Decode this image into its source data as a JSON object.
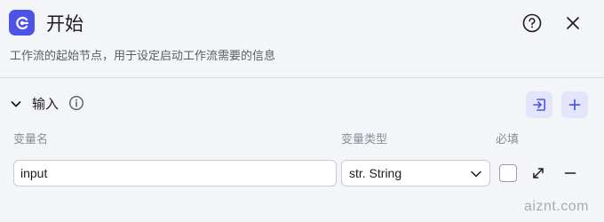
{
  "header": {
    "title": "开始",
    "description": "工作流的起始节点，用于设定启动工作流需要的信息",
    "icons": {
      "node": "start-node-icon",
      "help": "help-circle-icon",
      "close": "close-icon"
    }
  },
  "inputs_section": {
    "title": "输入",
    "icons": {
      "collapse": "chevron-down-icon",
      "info": "info-icon",
      "import": "import-icon",
      "add": "plus-icon"
    },
    "columns": {
      "name": "变量名",
      "type": "变量类型",
      "required": "必填"
    },
    "rows": [
      {
        "name": "input",
        "type": "str. String",
        "required": false
      }
    ]
  },
  "watermark": "aiznt.com",
  "colors": {
    "accent": "#4d53e8",
    "accent_soft": "#e3e5fb",
    "background": "#f4f5f9"
  }
}
